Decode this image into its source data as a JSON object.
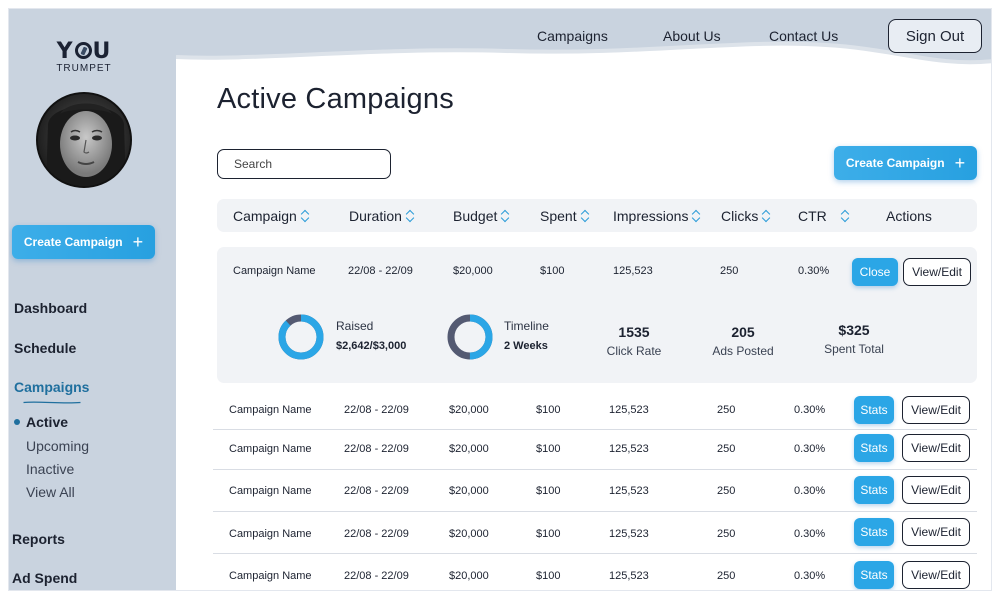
{
  "brand": {
    "logo_main": "Y U",
    "logo_sub": "TRUMPET"
  },
  "sidebar": {
    "create_label": "Create Campaign",
    "nav": {
      "dashboard": "Dashboard",
      "schedule": "Schedule",
      "campaigns": "Campaigns",
      "reports": "Reports",
      "ad_spend": "Ad Spend"
    },
    "sub": {
      "active": "Active",
      "upcoming": "Upcoming",
      "inactive": "Inactive",
      "view_all": "View All"
    }
  },
  "header": {
    "nav": [
      "Campaigns",
      "About Us",
      "Contact Us"
    ],
    "sign_out": "Sign Out"
  },
  "main": {
    "title": "Active Campaigns",
    "search_placeholder": "Search",
    "create_label": "Create Campaign"
  },
  "table": {
    "columns": [
      "Campaign",
      "Duration",
      "Budget",
      "Spent",
      "Impressions",
      "Clicks",
      "CTR",
      "Actions"
    ],
    "expanded": {
      "row": [
        "Campaign Name",
        "22/08 - 22/09",
        "$20,000",
        "$100",
        "125,523",
        "250",
        "0.30%"
      ],
      "close_label": "Close",
      "view_label": "View/Edit",
      "raised_label": "Raised",
      "raised_value": "$2,642/$3,000",
      "raised_fraction": 0.88,
      "timeline_label": "Timeline",
      "timeline_value": "2 Weeks",
      "timeline_fraction": 0.5,
      "click_rate_value": "1535",
      "click_rate_label": "Click Rate",
      "ads_posted_value": "205",
      "ads_posted_label": "Ads Posted",
      "spent_total_value": "$325",
      "spent_total_label": "Spent Total"
    },
    "rows": [
      [
        "Campaign Name",
        "22/08 - 22/09",
        "$20,000",
        "$100",
        "125,523",
        "250",
        "0.30%"
      ],
      [
        "Campaign Name",
        "22/08 - 22/09",
        "$20,000",
        "$100",
        "125,523",
        "250",
        "0.30%"
      ],
      [
        "Campaign Name",
        "22/08 - 22/09",
        "$20,000",
        "$100",
        "125,523",
        "250",
        "0.30%"
      ],
      [
        "Campaign Name",
        "22/08 - 22/09",
        "$20,000",
        "$100",
        "125,523",
        "250",
        "0.30%"
      ],
      [
        "Campaign Name",
        "22/08 - 22/09",
        "$20,000",
        "$100",
        "125,523",
        "250",
        "0.30%"
      ]
    ],
    "stats_label": "Stats",
    "view_label": "View/Edit"
  },
  "colors": {
    "accent": "#2ba6e6",
    "sidebar_bg": "#c9d3df",
    "ring_track": "#545a72",
    "ring_fill": "#2ba6e6"
  }
}
